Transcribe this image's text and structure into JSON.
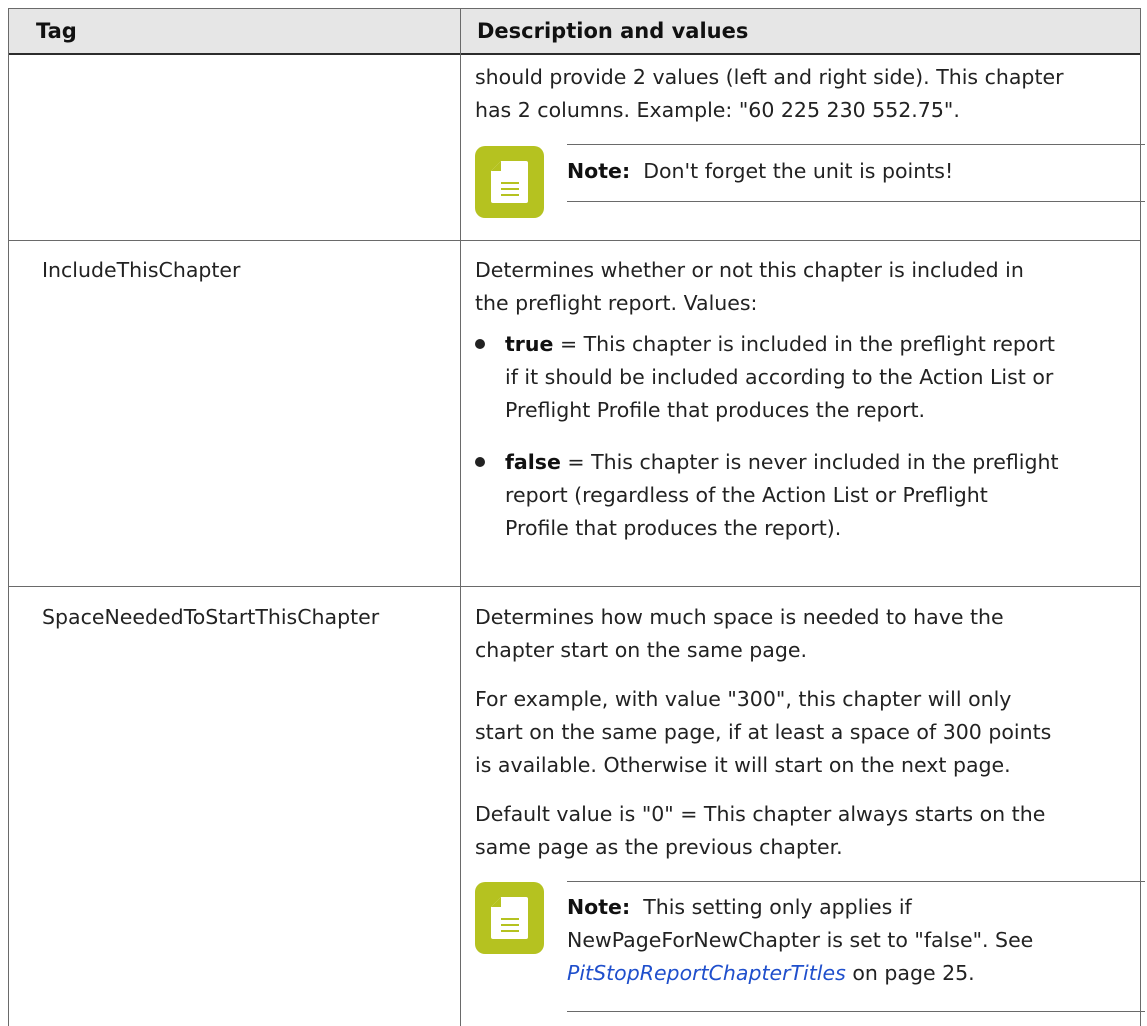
{
  "header": {
    "tag_label": "Tag",
    "desc_label": "Description and values"
  },
  "row1": {
    "tag": "",
    "line1": "should provide 2 values (left and right side). This chapter",
    "line2": "has 2 columns. Example: \"60 225 230 552.75\".",
    "note_label": "Note:",
    "note_text": "Don't forget the unit is points!"
  },
  "row2": {
    "tag": "IncludeThisChapter",
    "intro_l1": "Determines whether or not this chapter is included in",
    "intro_l2": "the preflight report. Values:",
    "b1_term": "true",
    "b1_l1": " = This chapter is included in the preflight report",
    "b1_l2": "if it should be included according to the Action List or",
    "b1_l3": "Preflight Profile that produces the report.",
    "b2_term": "false",
    "b2_l1": " = This chapter is never included in the preflight",
    "b2_l2": "report (regardless of the Action List or Preflight",
    "b2_l3": "Profile that produces the report)."
  },
  "row3": {
    "tag": "SpaceNeededToStartThisChapter",
    "p1_l1": "Determines how much space is needed to have the",
    "p1_l2": "chapter start on the same page.",
    "p2_l1": "For example, with value \"300\", this chapter will only",
    "p2_l2": "start on the same page, if at least a space of 300 points",
    "p2_l3": "is available. Otherwise it will start on the next page.",
    "p3_l1": "Default value is \"0\" = This chapter always starts on the",
    "p3_l2": "same page as the previous chapter.",
    "note_label": "Note:",
    "note_l1": "This setting only applies if",
    "note_l2": "NewPageForNewChapter is set to \"false\". See",
    "note_link": "PitStopReportChapterTitles",
    "note_after_link": " on page 25."
  },
  "colors": {
    "note_icon": "#b5c220",
    "link": "#1f4fcc",
    "header_bg": "#e6e6e6"
  },
  "icons": {
    "note": "note-document-icon"
  }
}
